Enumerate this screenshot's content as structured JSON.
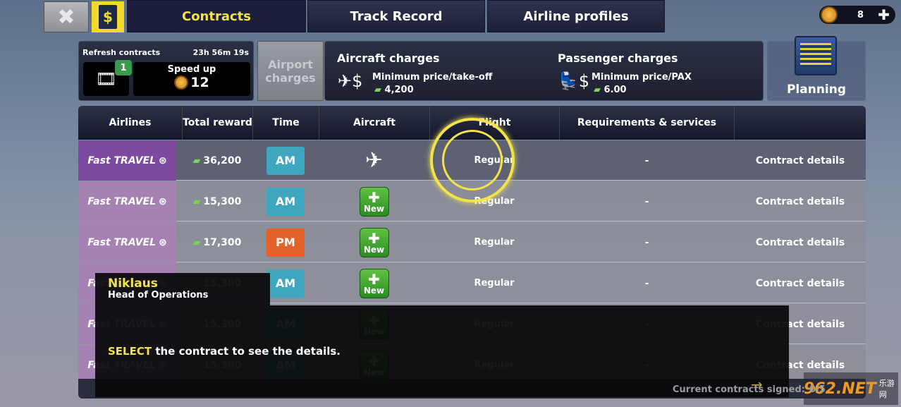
{
  "top": {
    "tabs": [
      "Contracts",
      "Track Record",
      "Airline profiles"
    ],
    "active_tab": "Contracts",
    "currency_amount": "8"
  },
  "refresh": {
    "label": "Refresh contracts",
    "timer": "23h 56m 19s",
    "video_badge": "1",
    "speed_up_label": "Speed up",
    "speed_up_cost": "12"
  },
  "charges": {
    "airport_button": "Airport charges",
    "aircraft_title": "Aircraft charges",
    "aircraft_sub": "Minimum price/take-off",
    "aircraft_value": "4,200",
    "passenger_title": "Passenger charges",
    "passenger_sub": "Minimum price/PAX",
    "passenger_value": "6.00"
  },
  "planning_label": "Planning",
  "table": {
    "headers": [
      "Airlines",
      "Total reward",
      "Time",
      "Aircraft",
      "Flight",
      "Requirements & services"
    ],
    "rows": [
      {
        "airline": "Fast TRAVEL",
        "reward": "36,200",
        "time": "AM",
        "aircraft": "plane",
        "flight": "Regular",
        "req": "-",
        "details": "Contract details"
      },
      {
        "airline": "Fast TRAVEL",
        "reward": "15,300",
        "time": "AM",
        "aircraft": "New",
        "flight": "Regular",
        "req": "-",
        "details": "Contract details"
      },
      {
        "airline": "Fast TRAVEL",
        "reward": "17,300",
        "time": "PM",
        "aircraft": "New",
        "flight": "Regular",
        "req": "-",
        "details": "Contract details"
      },
      {
        "airline": "Fast TRAVEL",
        "reward": "15,300",
        "time": "AM",
        "aircraft": "New",
        "flight": "Regular",
        "req": "-",
        "details": "Contract details"
      },
      {
        "airline": "Fast TRAVEL",
        "reward": "15,300",
        "time": "AM",
        "aircraft": "New",
        "flight": "Regular",
        "req": "-",
        "details": "Contract details"
      },
      {
        "airline": "Fast TRAVEL",
        "reward": "15,300",
        "time": "AM",
        "aircraft": "New",
        "flight": "Regular",
        "req": "-",
        "details": "Contract details"
      }
    ],
    "footer_label": "Current contracts signed:",
    "footer_value": "0/5"
  },
  "colors": {
    "am": "#3ea6bf",
    "pm": "#e2622a",
    "accent": "#f2e34a"
  },
  "tutorial": {
    "name": "Niklaus",
    "role": "Head of Operations",
    "highlight": "SELECT",
    "message": " the contract to see the details."
  },
  "watermark": {
    "text": "962.NET",
    "sub": "乐游网"
  }
}
